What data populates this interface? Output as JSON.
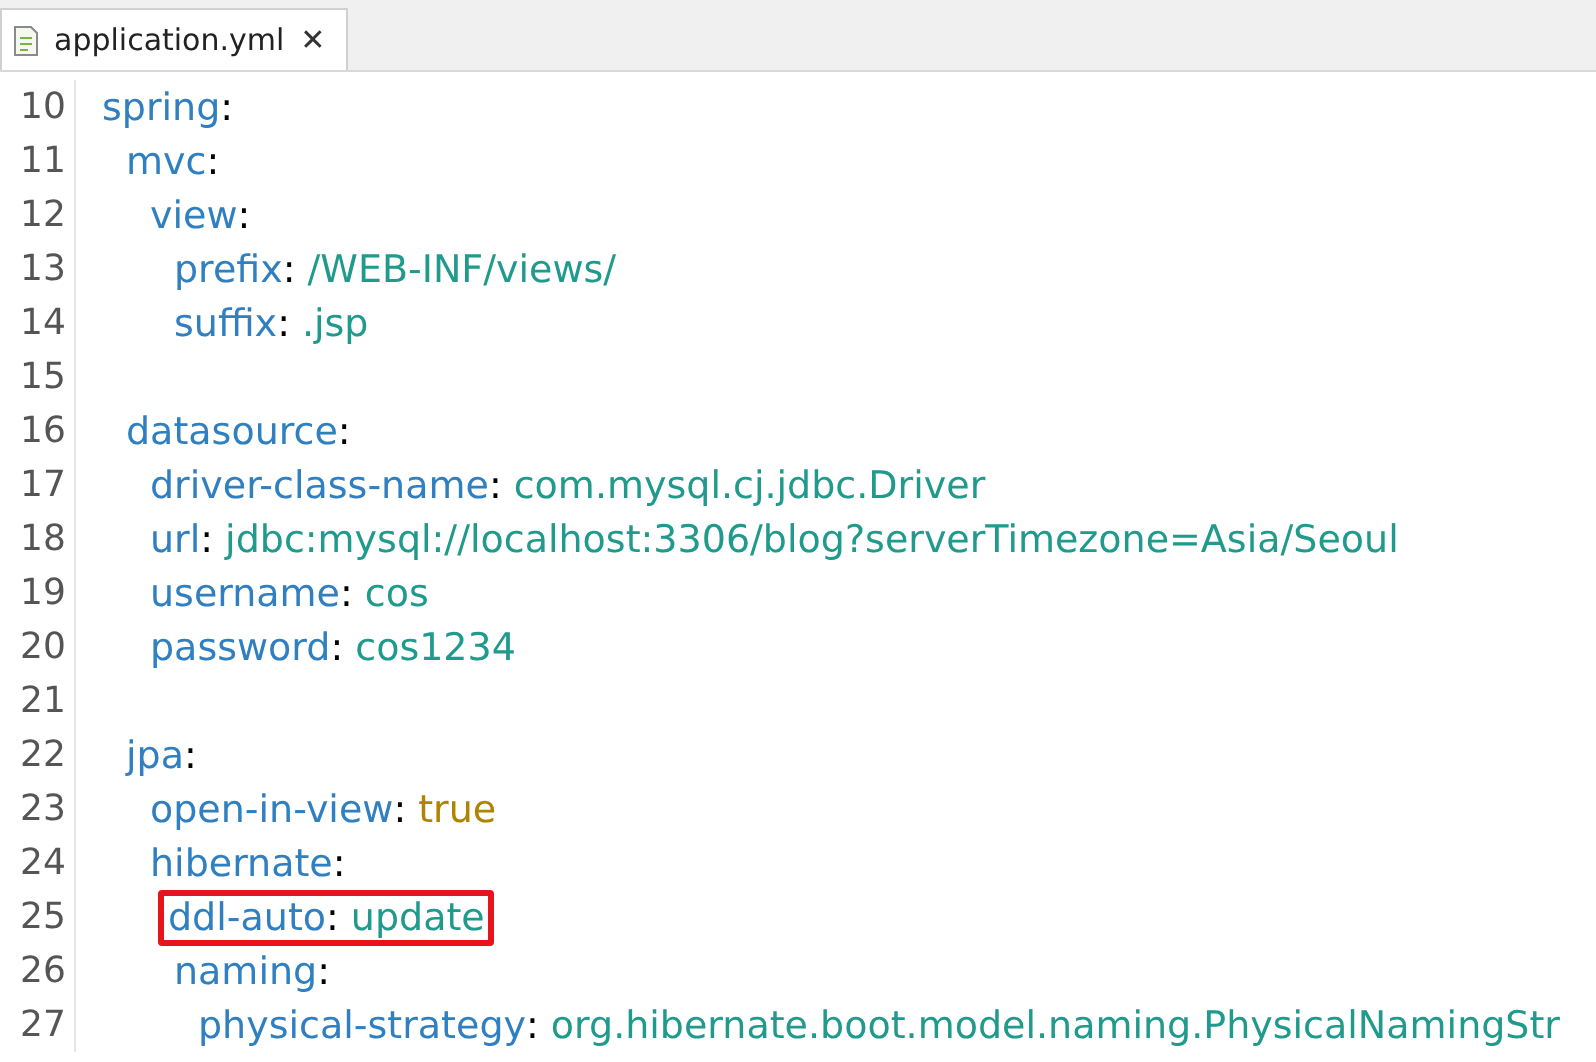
{
  "tab": {
    "title": "application.yml",
    "close": "✕",
    "selected": true
  },
  "lines": [
    {
      "line": "10",
      "key": "spring",
      "sep": ":",
      "children": [
        {
          "line": "11",
          "key": "mvc",
          "sep": ":",
          "children": [
            {
              "line": "12",
              "key": "view",
              "sep": ":",
              "children": [
                {
                  "line": "13",
                  "key": "prefix",
                  "sep": ":",
                  "value": "/WEB-INF/views/",
                  "kind": "string"
                },
                {
                  "line": "14",
                  "key": "suffix",
                  "sep": ":",
                  "value": ".jsp",
                  "kind": "string"
                }
              ]
            }
          ]
        },
        {
          "line": "15"
        },
        {
          "line": "16",
          "key": "datasource",
          "sep": ":",
          "children": [
            {
              "line": "17",
              "key": "driver-class-name",
              "sep": ":",
              "value": "com.mysql.cj.jdbc.Driver",
              "kind": "string"
            },
            {
              "line": "18",
              "key": "url",
              "sep": ":",
              "value": "jdbc:mysql://localhost:3306/blog?serverTimezone=Asia/Seoul",
              "kind": "string"
            },
            {
              "line": "19",
              "key": "username",
              "sep": ":",
              "value": "cos",
              "kind": "string"
            },
            {
              "line": "20",
              "key": "password",
              "sep": ":",
              "value": "cos1234",
              "kind": "string"
            }
          ]
        },
        {
          "line": "21"
        },
        {
          "line": "22",
          "key": "jpa",
          "sep": ":",
          "children": [
            {
              "line": "23",
              "key": "open-in-view",
              "sep": ":",
              "value": "true",
              "kind": "boolean"
            },
            {
              "line": "24",
              "key": "hibernate",
              "sep": ":",
              "children": [
                {
                  "line": "25",
                  "key": "ddl-auto",
                  "sep": ":",
                  "value": "update",
                  "kind": "string",
                  "highlighted": true
                },
                {
                  "line": "26",
                  "key": "naming",
                  "sep": ":",
                  "children": [
                    {
                      "line": "27",
                      "key": "physical-strategy",
                      "sep": ":",
                      "value": "org.hibernate.boot.model.naming.PhysicalNamingStr",
                      "kind": "string"
                    }
                  ]
                }
              ]
            }
          ]
        }
      ]
    }
  ]
}
